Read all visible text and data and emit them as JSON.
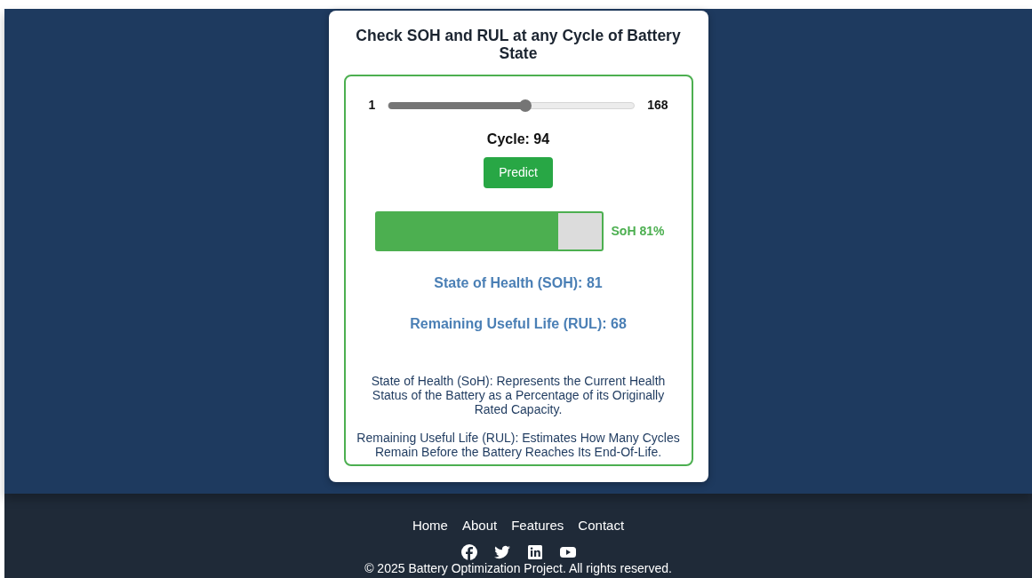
{
  "card": {
    "title": "Check SOH and RUL at any Cycle of Battery State",
    "slider": {
      "min_label": "1",
      "max_label": "168",
      "level": 0.556
    },
    "cycle_label": "Cycle: 94",
    "predict_button": "Predict",
    "soh_bar": {
      "level": 0.81,
      "label": "SoH 81%"
    },
    "results": [
      "State of Health (SOH): 81",
      "Remaining Useful Life (RUL): 68"
    ],
    "descriptions": [
      "State of Health (SoH): Represents the Current Health Status of the Battery as a Percentage of its Originally Rated Capacity.",
      "Remaining Useful Life (RUL): Estimates How Many Cycles Remain Before the Battery Reaches Its End-Of-Life."
    ]
  },
  "footer": {
    "links": [
      "Home",
      "About",
      "Features",
      "Contact"
    ],
    "social": [
      {
        "kind": "facebook"
      },
      {
        "kind": "twitter"
      },
      {
        "kind": "linkedin"
      },
      {
        "kind": "youtube"
      }
    ],
    "copyright": "© 2025 Battery Optimization Project. All rights reserved."
  }
}
